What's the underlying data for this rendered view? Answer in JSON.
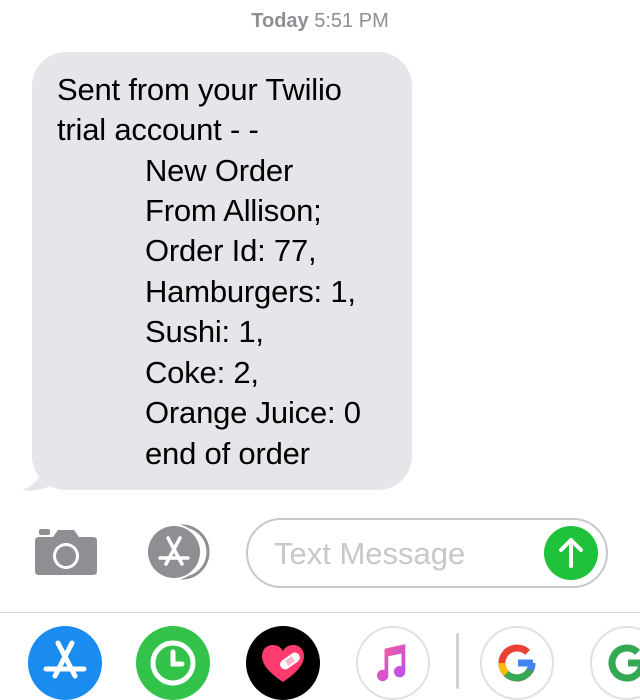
{
  "header": {
    "timestamp_day": "Today",
    "timestamp_time": "5:51 PM"
  },
  "message": {
    "lines": [
      "Sent from your Twilio",
      "trial account - -",
      "New Order",
      "From Allison;",
      "Order Id: 77,",
      "Hamburgers: 1,",
      "Sushi: 1,",
      "Coke: 2,",
      "Orange Juice: 0",
      "end of order"
    ]
  },
  "compose": {
    "placeholder": "Text Message"
  },
  "app_tray": {
    "apps": [
      "app-store-icon",
      "activity-clock-icon",
      "digital-touch-icon",
      "music-icon",
      "google-icon",
      "google-icon-partial"
    ]
  },
  "colors": {
    "bubble": "#e5e5ea",
    "send": "#1ec33b",
    "placeholder": "#c7c7cc"
  }
}
